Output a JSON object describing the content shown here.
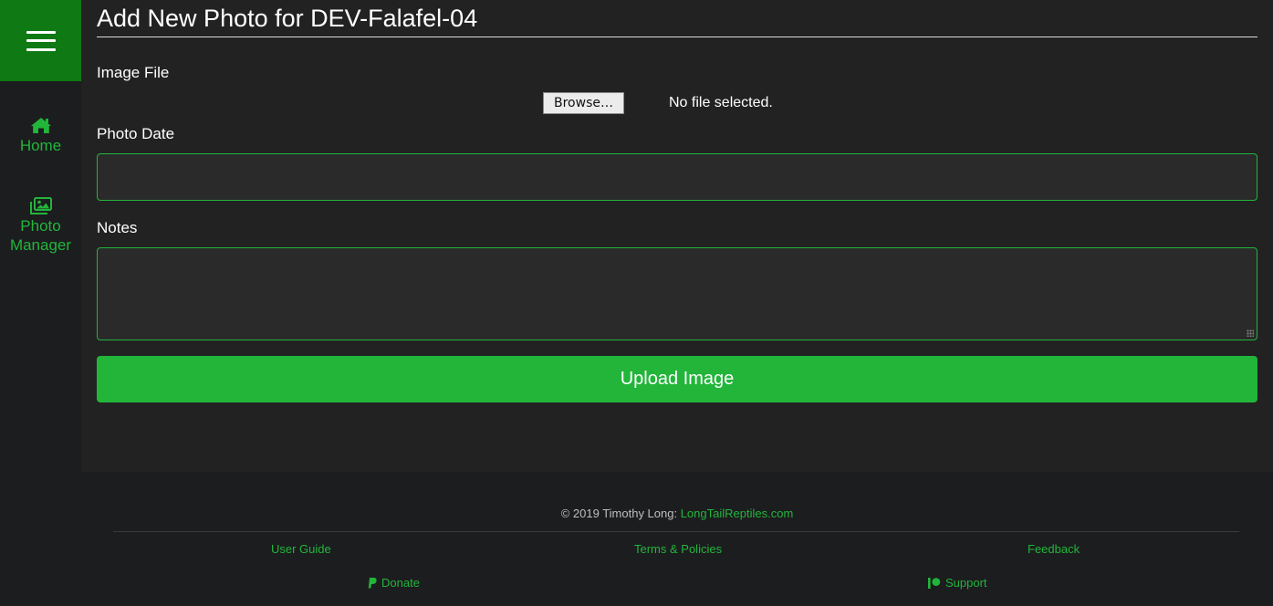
{
  "sidebar": {
    "menu_icon": "hamburger-icon",
    "items": [
      {
        "label": "Home",
        "icon": "home-icon"
      },
      {
        "label": "Photo Manager",
        "icon": "photo-gallery-icon"
      }
    ]
  },
  "form": {
    "title": "Add New Photo for DEV-Falafel-04",
    "image_file_label": "Image File",
    "browse_label": "Browse…",
    "file_status": "No file selected.",
    "photo_date_label": "Photo Date",
    "photo_date_value": "",
    "notes_label": "Notes",
    "notes_value": "",
    "submit_label": "Upload Image"
  },
  "footer": {
    "copyright_text": "© 2019 Timothy Long: ",
    "site_link": "LongTailReptiles.com",
    "links": {
      "user_guide": "User Guide",
      "terms": "Terms & Policies",
      "feedback": "Feedback",
      "donate": "Donate",
      "support": "Support"
    },
    "donate_icon": "paypal-icon",
    "support_icon": "patreon-icon"
  },
  "colors": {
    "accent": "#22b53a",
    "header_green": "#0f7a14",
    "background": "#1c1d1f",
    "panel": "#222223",
    "field_bg": "#2a2a2b"
  }
}
